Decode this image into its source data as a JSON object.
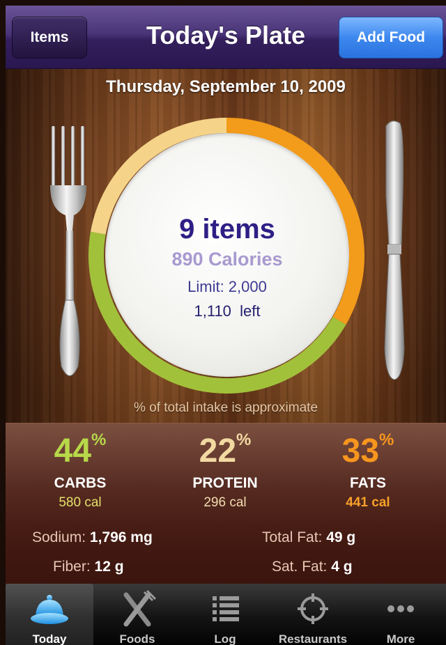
{
  "nav": {
    "title": "Today's Plate",
    "left_button": "Items",
    "right_button": "Add Food"
  },
  "date": "Thursday, September 10, 2009",
  "plate": {
    "items": "9 items",
    "calories": "890 Calories",
    "limit": "Limit: 2,000",
    "left": "1,110  left",
    "ring_segments_pct": {
      "carbs": 44,
      "protein": 22,
      "fats": 33
    },
    "colors": {
      "carbs": "#a2c13a",
      "protein": "#f5d48a",
      "fats": "#f39b1a"
    }
  },
  "note": "% of total intake is approximate",
  "macros": [
    {
      "value": "44",
      "pct": "%",
      "name": "CARBS",
      "cal": "580 cal",
      "color": "#b7d84a",
      "cal_color": "#e4e06a"
    },
    {
      "value": "22",
      "pct": "%",
      "name": "PROTEIN",
      "cal": "296 cal",
      "color": "#f2d9a2",
      "cal_color": "#f3ddb0"
    },
    {
      "value": "33",
      "pct": "%",
      "name": "FATS",
      "cal": "441 cal",
      "color": "#f7961e",
      "cal_color": "#f9a12a"
    }
  ],
  "nutrients": {
    "sodium_label": "Sodium:",
    "sodium": "1,796 mg",
    "fiber_label": "Fiber:",
    "fiber": "12 g",
    "total_fat_label": "Total Fat:",
    "total_fat": "49 g",
    "sat_fat_label": "Sat. Fat:",
    "sat_fat": "4 g"
  },
  "tabs": [
    {
      "label": "Today",
      "icon": "plate-cloche-icon",
      "active": true
    },
    {
      "label": "Foods",
      "icon": "fork-knife-icon",
      "active": false
    },
    {
      "label": "Log",
      "icon": "list-icon",
      "active": false
    },
    {
      "label": "Restaurants",
      "icon": "crosshair-icon",
      "active": false
    },
    {
      "label": "More",
      "icon": "more-dots-icon",
      "active": false
    }
  ]
}
